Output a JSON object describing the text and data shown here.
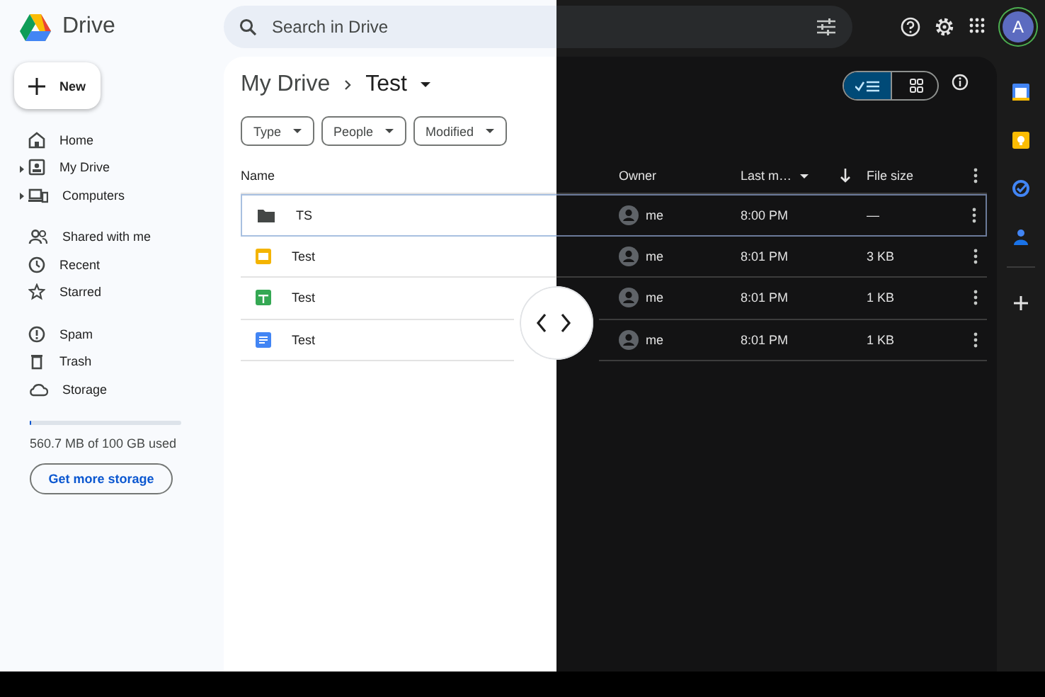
{
  "app": {
    "name": "Drive"
  },
  "search": {
    "placeholder": "Search in Drive"
  },
  "account": {
    "initial": "A"
  },
  "new_button": {
    "label": "New"
  },
  "sidebar": {
    "groups": [
      {
        "items": [
          {
            "kind": "home",
            "label": "Home",
            "expandable": false
          },
          {
            "kind": "my-drive",
            "label": "My Drive",
            "expandable": true
          },
          {
            "kind": "computers",
            "label": "Computers",
            "expandable": true
          }
        ]
      },
      {
        "items": [
          {
            "kind": "shared",
            "label": "Shared with me",
            "expandable": false
          },
          {
            "kind": "recent",
            "label": "Recent",
            "expandable": false
          },
          {
            "kind": "starred",
            "label": "Starred",
            "expandable": false
          }
        ]
      },
      {
        "items": [
          {
            "kind": "spam",
            "label": "Spam",
            "expandable": false
          },
          {
            "kind": "trash",
            "label": "Trash",
            "expandable": false
          },
          {
            "kind": "storage",
            "label": "Storage",
            "expandable": false
          }
        ]
      }
    ]
  },
  "storage": {
    "level": 0.006,
    "text": "560.7 MB of 100 GB used",
    "button": "Get more storage"
  },
  "breadcrumb": [
    {
      "label": "My Drive",
      "current": false
    },
    {
      "label": "Test",
      "current": true
    }
  ],
  "filters": [
    "Type",
    "People",
    "Modified"
  ],
  "view_toggle": [
    {
      "kind": "list",
      "selected": true
    },
    {
      "kind": "grid",
      "selected": false
    }
  ],
  "table": {
    "columns": [
      {
        "label": "Name"
      },
      {
        "label": "Owner"
      },
      {
        "label": "Last m…"
      },
      {
        "label": "File size"
      }
    ],
    "rows": [
      {
        "kind": "folder",
        "name": "TS",
        "owner": "me",
        "modified": "8:00 PM",
        "size": "—",
        "selected": true
      },
      {
        "kind": "slides",
        "name": "Test",
        "owner": "me",
        "modified": "8:01 PM",
        "size": "3 KB",
        "selected": false
      },
      {
        "kind": "sheets",
        "name": "Test",
        "owner": "me",
        "modified": "8:01 PM",
        "size": "1 KB",
        "selected": false
      },
      {
        "kind": "docs",
        "name": "Test",
        "owner": "me",
        "modified": "8:01 PM",
        "size": "1 KB",
        "selected": false
      }
    ]
  }
}
